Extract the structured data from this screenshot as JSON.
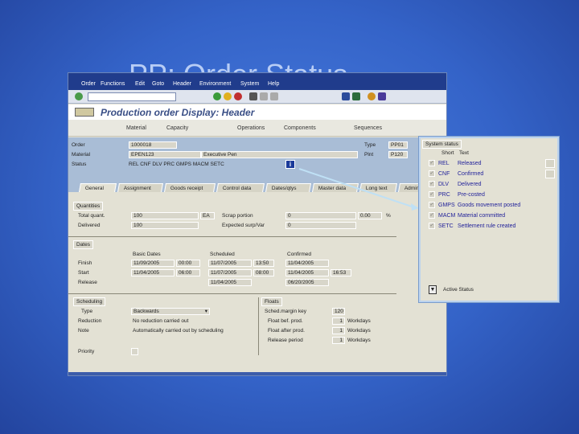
{
  "slide": {
    "title": "PP: Order Status"
  },
  "sap": {
    "menu": [
      "Order",
      "Functions",
      "Edit",
      "Goto",
      "Header",
      "Environment",
      "System",
      "Help"
    ],
    "page_title": "Production order Display: Header",
    "app_toolbar": {
      "material": "Material",
      "capacity": "Capacity",
      "operations": "Operations",
      "components": "Components",
      "sequences": "Sequences"
    },
    "header": {
      "order_label": "Order",
      "order_value": "1000018",
      "material_label": "Material",
      "material_value": "EPEN123",
      "material_desc": "Executive Pen",
      "status_label": "Status",
      "status_value": "REL  CNF DLV  PRC  GMPS MACM SETC",
      "type_label": "Type",
      "type_value": "PP01",
      "plant_label": "Plnt",
      "plant_value": "P120"
    },
    "tabs": [
      "General",
      "Assignment",
      "Goods receipt",
      "Control data",
      "Dates/qtys",
      "Master data",
      "Long text",
      "Admin"
    ],
    "quantities": {
      "group": "Quantities",
      "total_label": "Total quant.",
      "total_value": "100",
      "unit": "EA",
      "scrap_label": "Scrap portion",
      "scrap_value": "0",
      "scrap_pct": "0.00",
      "pct_sign": "%",
      "delivered_label": "Delivered",
      "delivered_value": "100",
      "expected_label": "Expected surp/Var",
      "expected_value": "0"
    },
    "dates": {
      "group": "Dates",
      "col_basic": "Basic Dates",
      "col_scheduled": "Scheduled",
      "col_confirmed": "Confirmed",
      "rows": [
        {
          "label": "Finish",
          "basic_date": "11/09/2005",
          "basic_time": "00:00",
          "sched_date": "11/07/2005",
          "sched_time": "13:50",
          "conf_date": "11/04/2005",
          "conf_time": ""
        },
        {
          "label": "Start",
          "basic_date": "11/04/2005",
          "basic_time": "06:00",
          "sched_date": "11/07/2005",
          "sched_time": "08:00",
          "conf_date": "11/04/2005",
          "conf_time": "16:53"
        },
        {
          "label": "Release",
          "basic_date": "",
          "basic_time": "",
          "sched_date": "11/04/2005",
          "sched_time": "",
          "conf_date": "06/20/2005",
          "conf_time": ""
        }
      ]
    },
    "scheduling": {
      "group": "Scheduling",
      "type_label": "Type",
      "type_value": "Backwards",
      "reduction_label": "Reduction",
      "reduction_value": "No reduction carried out",
      "note_label": "Note",
      "note_value": "Automatically carried out by scheduling",
      "priority_label": "Priority"
    },
    "floats": {
      "group": "Floats",
      "margin_label": "Sched.margin key",
      "margin_value": "120",
      "before_label": "Float bef. prod.",
      "before_value": "1",
      "after_label": "Float after prod.",
      "after_value": "1",
      "release_label": "Release period",
      "release_value": "1",
      "unit": "Workdays"
    }
  },
  "popup": {
    "group": "System status",
    "col_short": "Short",
    "col_text": "Text",
    "rows": [
      {
        "code": "REL",
        "text": "Released"
      },
      {
        "code": "CNF",
        "text": "Confirmed"
      },
      {
        "code": "DLV",
        "text": "Delivered"
      },
      {
        "code": "PRC",
        "text": "Pre-costed"
      },
      {
        "code": "GMPS",
        "text": "Goods movement posted"
      },
      {
        "code": "MACM",
        "text": "Material committed"
      },
      {
        "code": "SETC",
        "text": "Settlement rule created"
      }
    ],
    "active_status": "Active Status"
  },
  "colors": {
    "background": "#3463c8",
    "sap_menubar": "#203c8c",
    "sap_header": "#a9bdd6",
    "sap_content": "#e3e1d4",
    "status_text": "#22229a"
  }
}
